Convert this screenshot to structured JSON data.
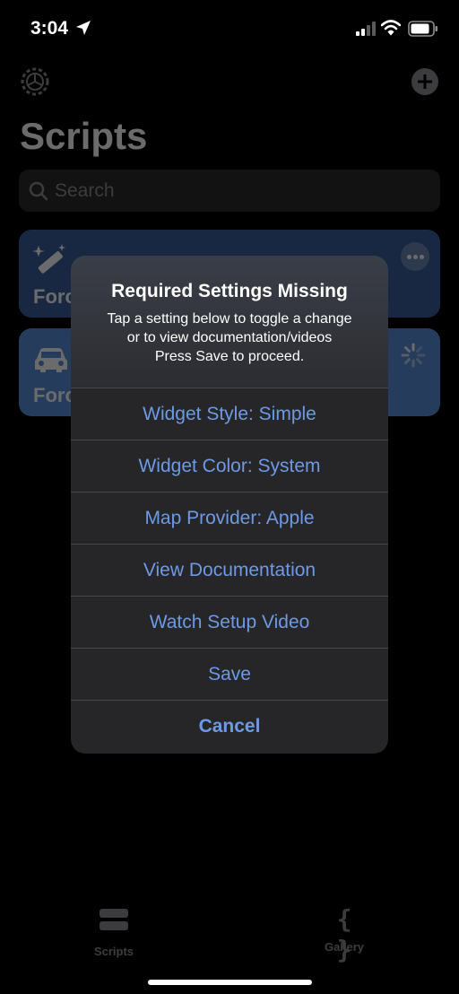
{
  "status_bar": {
    "time": "3:04"
  },
  "header": {
    "title": "Scripts"
  },
  "search": {
    "placeholder": "Search"
  },
  "cards": [
    {
      "label": "Forc",
      "icon": "magic-wand-icon",
      "color": "#3a5f9e"
    },
    {
      "label": "Forc",
      "icon": "car-icon",
      "color": "#5b8fdc"
    }
  ],
  "alert": {
    "title": "Required Settings Missing",
    "message_lines": [
      "Tap a setting below to toggle a change",
      "or to view documentation/videos",
      "Press Save to proceed."
    ],
    "buttons": [
      "Widget Style: Simple",
      "Widget Color: System",
      "Map Provider: Apple",
      "View Documentation",
      "Watch Setup Video",
      "Save"
    ],
    "cancel": "Cancel",
    "button_color": "#6d9ae6"
  },
  "tabbar": {
    "scripts_label": "Scripts",
    "gallery_label": "Gallery",
    "gallery_glyph": "{ }"
  }
}
